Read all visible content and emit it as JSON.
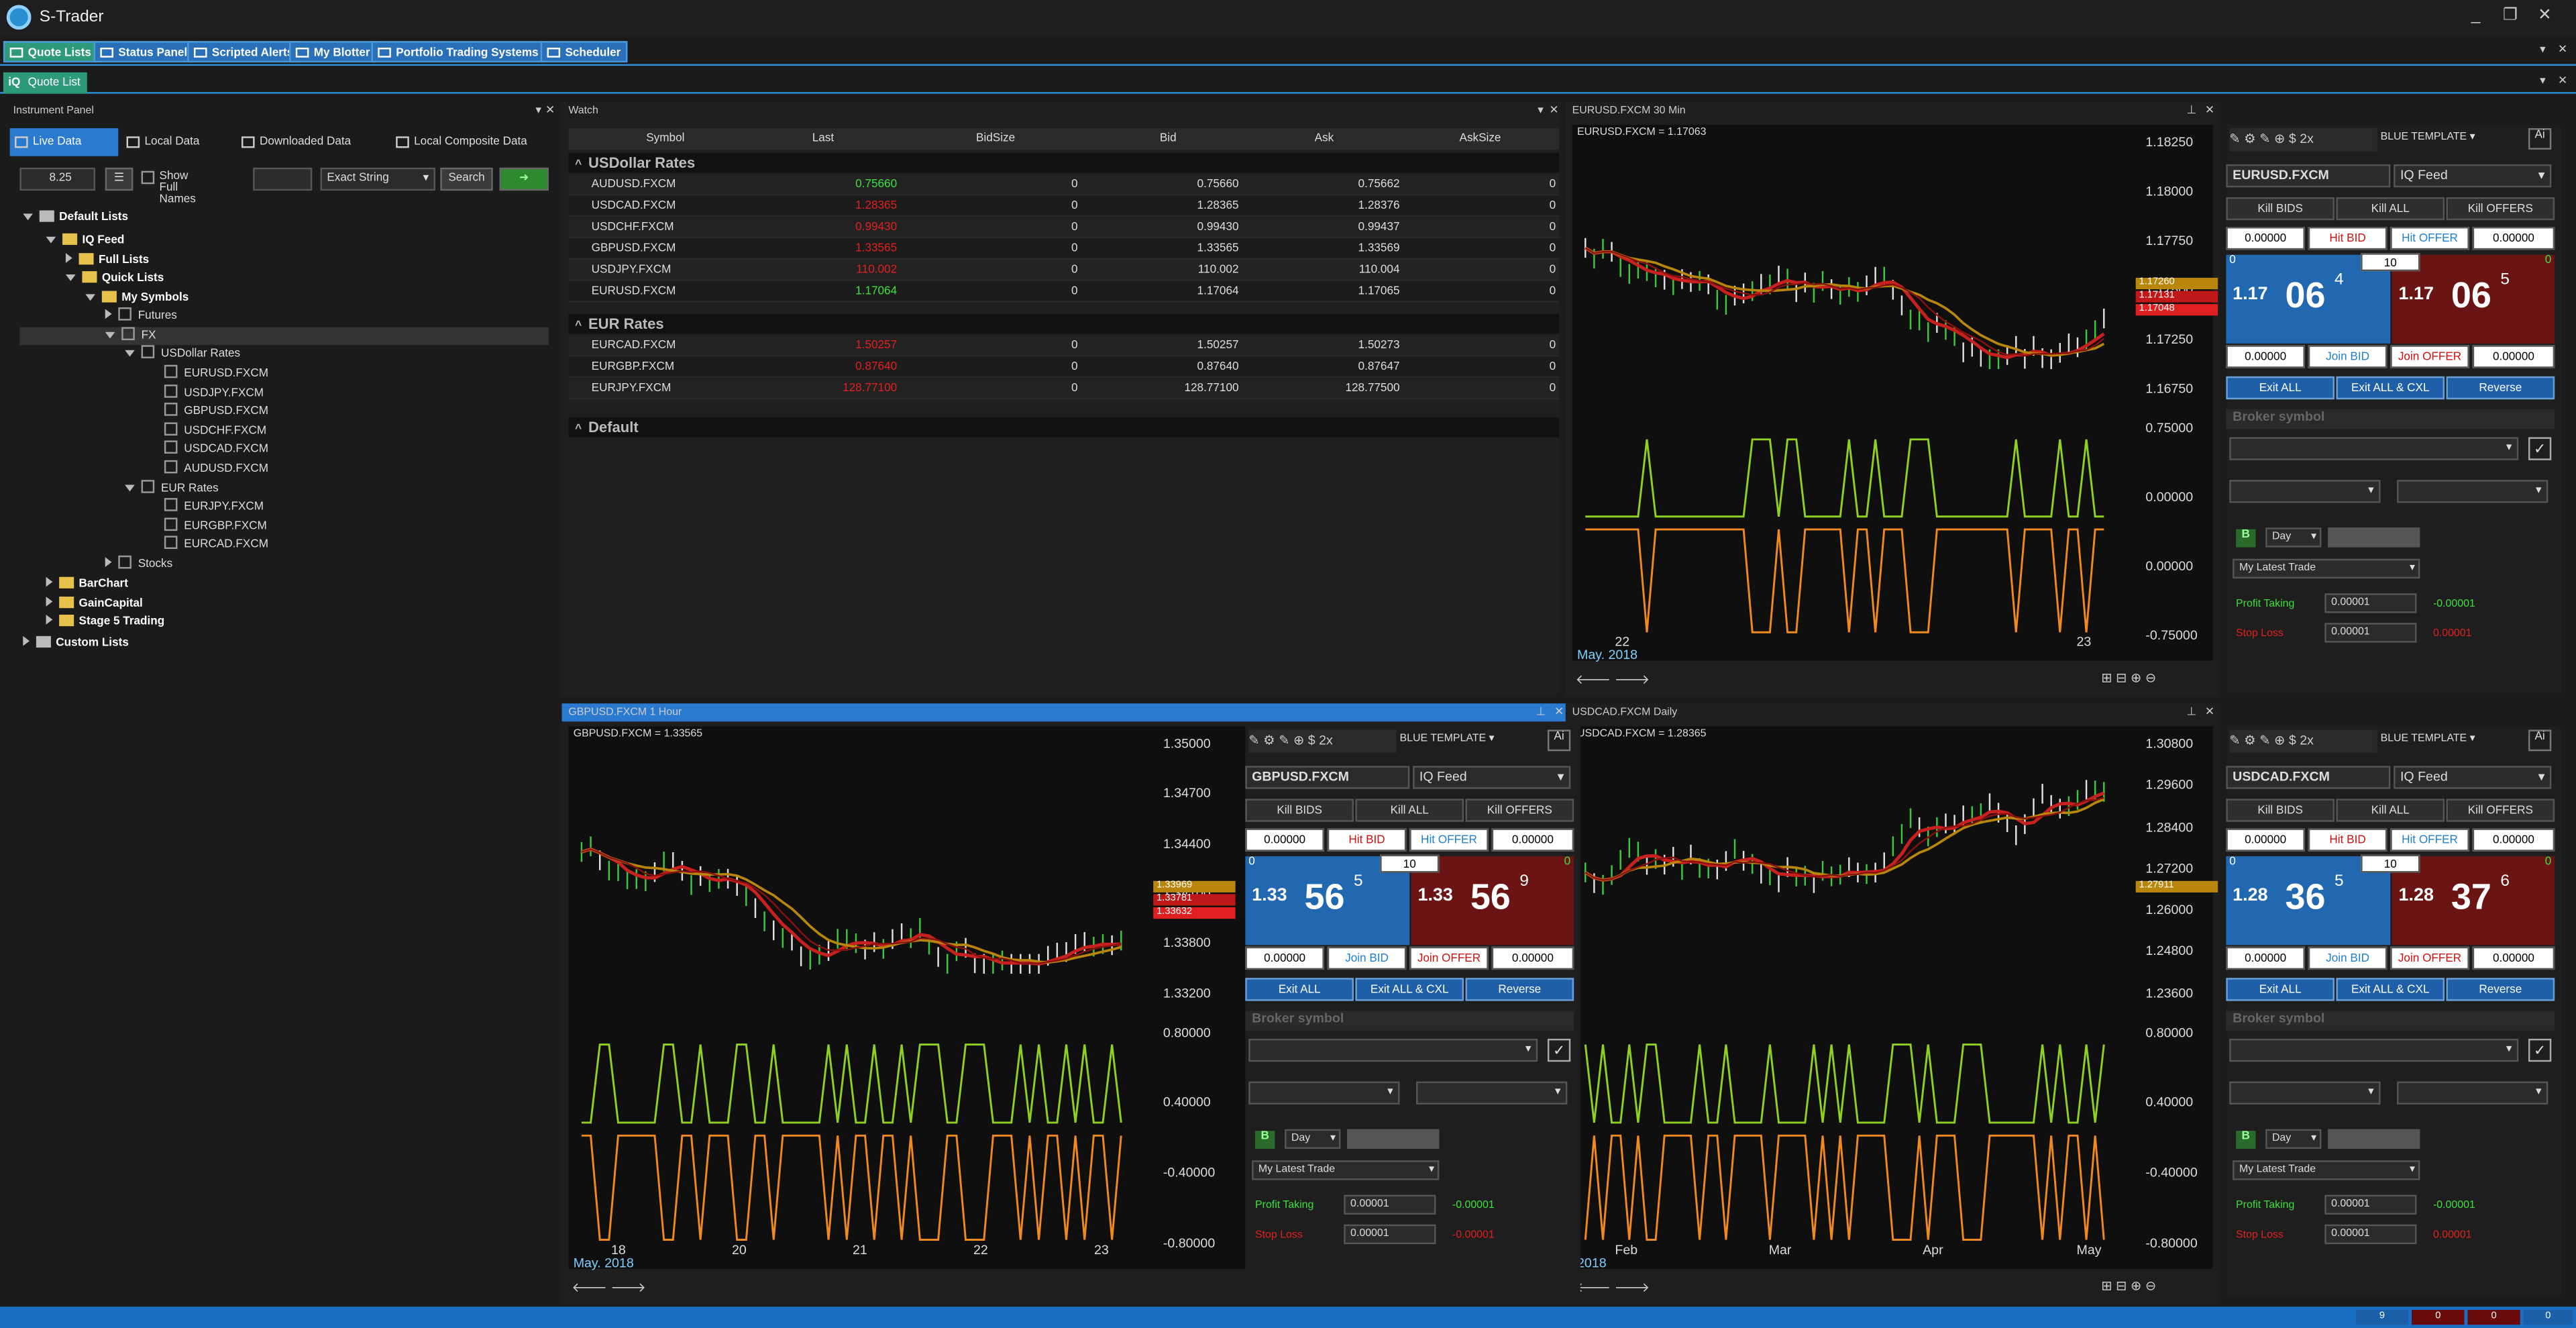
{
  "app": {
    "title": "S-Trader"
  },
  "toolbar": {
    "items": [
      "Quote Lists",
      "Status Panel",
      "Scripted Alerts",
      "My Blotter",
      "Portfolio Trading Systems",
      "Scheduler"
    ]
  },
  "tabs": {
    "quote_list": "Quote List"
  },
  "instrument_panel": {
    "title": "Instrument Panel",
    "tabs": [
      "Live Data",
      "Local Data",
      "Downloaded Data",
      "Local Composite Data"
    ],
    "font_size": "8.25",
    "show_full_names": "Show Full Names",
    "match_mode": "Exact String",
    "search": "Search",
    "tree": {
      "default_lists": "Default Lists",
      "iq_feed": "IQ Feed",
      "full_lists": "Full Lists",
      "quick_lists": "Quick Lists",
      "my_symbols": "My Symbols",
      "futures": "Futures",
      "fx": "FX",
      "usdollar_rates": "USDollar Rates",
      "usd_items": [
        "EURUSD.FXCM",
        "USDJPY.FXCM",
        "GBPUSD.FXCM",
        "USDCHF.FXCM",
        "USDCAD.FXCM",
        "AUDUSD.FXCM"
      ],
      "eur_rates": "EUR Rates",
      "eur_items": [
        "EURJPY.FXCM",
        "EURGBP.FXCM",
        "EURCAD.FXCM"
      ],
      "stocks": "Stocks",
      "barchart": "BarChart",
      "gaincapital": "GainCapital",
      "stage5": "Stage 5 Trading",
      "custom_lists": "Custom Lists"
    }
  },
  "watch": {
    "title": "Watch",
    "columns": [
      "Symbol",
      "Last",
      "BidSize",
      "Bid",
      "Ask",
      "AskSize"
    ],
    "groups": [
      {
        "name": "USDollar Rates",
        "rows": [
          {
            "symbol": "AUDUSD.FXCM",
            "last": "0.75660",
            "bidsize": "0",
            "bid": "0.75660",
            "ask": "0.75662",
            "asksize": "0",
            "color": "#3ee03e"
          },
          {
            "symbol": "USDCAD.FXCM",
            "last": "1.28365",
            "bidsize": "0",
            "bid": "1.28365",
            "ask": "1.28376",
            "asksize": "0",
            "color": "#e02020"
          },
          {
            "symbol": "USDCHF.FXCM",
            "last": "0.99430",
            "bidsize": "0",
            "bid": "0.99430",
            "ask": "0.99437",
            "asksize": "0",
            "color": "#e02020"
          },
          {
            "symbol": "GBPUSD.FXCM",
            "last": "1.33565",
            "bidsize": "0",
            "bid": "1.33565",
            "ask": "1.33569",
            "asksize": "0",
            "color": "#e02020"
          },
          {
            "symbol": "USDJPY.FXCM",
            "last": "110.002",
            "bidsize": "0",
            "bid": "110.002",
            "ask": "110.004",
            "asksize": "0",
            "color": "#e02020"
          },
          {
            "symbol": "EURUSD.FXCM",
            "last": "1.17064",
            "bidsize": "0",
            "bid": "1.17064",
            "ask": "1.17065",
            "asksize": "0",
            "color": "#3ee03e"
          }
        ]
      },
      {
        "name": "EUR Rates",
        "rows": [
          {
            "symbol": "EURCAD.FXCM",
            "last": "1.50257",
            "bidsize": "0",
            "bid": "1.50257",
            "ask": "1.50273",
            "asksize": "0",
            "color": "#e02020"
          },
          {
            "symbol": "EURGBP.FXCM",
            "last": "0.87640",
            "bidsize": "0",
            "bid": "0.87640",
            "ask": "0.87647",
            "asksize": "0",
            "color": "#e02020"
          },
          {
            "symbol": "EURJPY.FXCM",
            "last": "128.77100",
            "bidsize": "0",
            "bid": "128.77100",
            "ask": "128.77500",
            "asksize": "0",
            "color": "#e02020"
          }
        ]
      },
      {
        "name": "Default",
        "rows": []
      }
    ]
  },
  "charts": [
    {
      "title": "EURUSD.FXCM 30 Min",
      "legend": "EURUSD.FXCM = 1.17063",
      "yticks": [
        "1.18250",
        "1.18000",
        "1.17750",
        "1.17500",
        "1.17250",
        "1.16750"
      ],
      "ind_ticks": [
        "0.75000",
        "0.00000",
        "0.00000",
        "-0.75000"
      ],
      "xticks": [
        "22",
        "23"
      ],
      "date": "May. 2018",
      "tags": [
        "1.17260",
        "1.17131",
        "1.17048"
      ]
    },
    {
      "title": "GBPUSD.FXCM 1 Hour",
      "legend": "GBPUSD.FXCM = 1.33565",
      "yticks": [
        "1.35000",
        "1.34700",
        "1.34400",
        "1.34100",
        "1.33800",
        "1.33200"
      ],
      "ind_ticks": [
        "0.80000",
        "0.40000",
        "-0.40000",
        "-0.80000"
      ],
      "xticks": [
        "18",
        "20",
        "21",
        "22",
        "23"
      ],
      "date": "May. 2018",
      "tags": [
        "1.33969",
        "1.33781",
        "1.33632"
      ]
    },
    {
      "title": "USDCAD.FXCM Daily",
      "legend": "USDCAD.FXCM = 1.28365",
      "yticks": [
        "1.30800",
        "1.29600",
        "1.28400",
        "1.27200",
        "1.26000",
        "1.24800",
        "1.23600"
      ],
      "ind_ticks": [
        "0.80000",
        "0.40000",
        "-0.40000",
        "-0.80000"
      ],
      "xticks": [
        "Feb",
        "Mar",
        "Apr",
        "May"
      ],
      "date": "2018",
      "tags": [
        "1.27911"
      ]
    }
  ],
  "orders": [
    {
      "symbol": "EURUSD.FXCM",
      "feed": "IQ Feed",
      "template": "BLUE TEMPLATE",
      "big_bid": "1.17",
      "bid_main": "06",
      "bid_sup": "4",
      "big_ask": "1.17",
      "ask_main": "06",
      "ask_sup": "5",
      "qty": "10",
      "pt": "-0.00001",
      "sl": "0.00001"
    },
    {
      "symbol": "GBPUSD.FXCM",
      "feed": "IQ Feed",
      "template": "BLUE TEMPLATE",
      "big_bid": "1.33",
      "bid_main": "56",
      "bid_sup": "5",
      "big_ask": "1.33",
      "ask_main": "56",
      "ask_sup": "9",
      "qty": "10",
      "pt": "-0.00001",
      "sl": "-0.00001"
    },
    {
      "symbol": "USDCAD.FXCM",
      "feed": "IQ Feed",
      "template": "BLUE TEMPLATE",
      "big_bid": "1.28",
      "bid_main": "36",
      "bid_sup": "5",
      "big_ask": "1.28",
      "ask_main": "37",
      "ask_sup": "6",
      "qty": "10",
      "pt": "-0.00001",
      "sl": "0.00001"
    }
  ],
  "order_labels": {
    "kill_bids": "Kill BIDS",
    "kill_all": "Kill ALL",
    "kill_offers": "Kill OFFERS",
    "hit_bid": "Hit BID",
    "hit_offer": "Hit OFFER",
    "join_bid": "Join BID",
    "join_offer": "Join OFFER",
    "exit_all": "Exit ALL",
    "exit_all_cxl": "Exit ALL & CXL",
    "reverse": "Reverse",
    "broker_symbol": "Broker symbol",
    "day": "Day",
    "latest_trade": "My Latest Trade",
    "profit_taking": "Profit Taking",
    "stop_loss": "Stop Loss",
    "zero": "0.00000",
    "pt_val": "0.00001",
    "b": "B",
    "count_left": "0"
  },
  "status": {
    "counts": [
      "9",
      "0",
      "0",
      "0"
    ]
  }
}
